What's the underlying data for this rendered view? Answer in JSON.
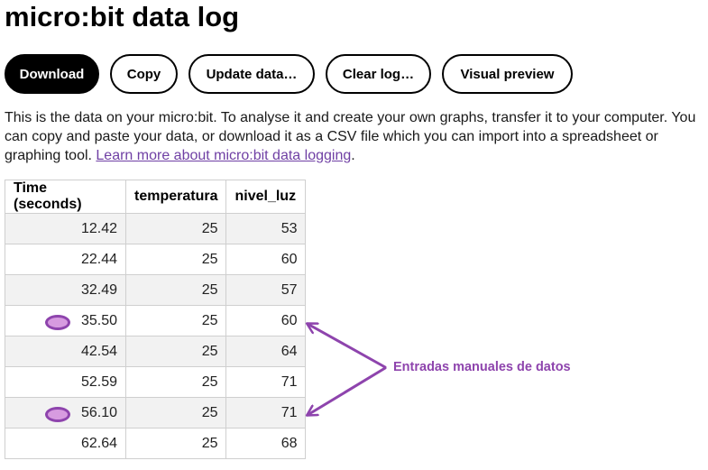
{
  "title": "micro:bit data log",
  "toolbar": {
    "download_label": "Download",
    "copy_label": "Copy",
    "update_label": "Update data…",
    "clear_label": "Clear log…",
    "preview_label": "Visual preview"
  },
  "intro": {
    "text": "This is the data on your micro:bit. To analyse it and create your own graphs, transfer it to your computer. You can copy and paste your data, or download it as a CSV file which you can import into a spreadsheet or graphing tool. ",
    "link_text": "Learn more about micro:bit data logging",
    "suffix": "."
  },
  "table": {
    "headers": [
      "Time (seconds)",
      "temperatura",
      "nivel_luz"
    ],
    "rows": [
      {
        "time": "12.42",
        "temperatura": "25",
        "nivel_luz": "53",
        "marked": false
      },
      {
        "time": "22.44",
        "temperatura": "25",
        "nivel_luz": "60",
        "marked": false
      },
      {
        "time": "32.49",
        "temperatura": "25",
        "nivel_luz": "57",
        "marked": false
      },
      {
        "time": "35.50",
        "temperatura": "25",
        "nivel_luz": "60",
        "marked": true
      },
      {
        "time": "42.54",
        "temperatura": "25",
        "nivel_luz": "64",
        "marked": false
      },
      {
        "time": "52.59",
        "temperatura": "25",
        "nivel_luz": "71",
        "marked": false
      },
      {
        "time": "56.10",
        "temperatura": "25",
        "nivel_luz": "71",
        "marked": true
      },
      {
        "time": "62.64",
        "temperatura": "25",
        "nivel_luz": "68",
        "marked": false
      }
    ]
  },
  "annotation": {
    "label": "Entradas manuales de datos",
    "color": "#8e44ad",
    "marker_fill": "#d79be0"
  },
  "colors": {
    "primary_button_bg": "#000000",
    "link": "#6f3fa4",
    "row_stripe": "#f2f2f2"
  }
}
